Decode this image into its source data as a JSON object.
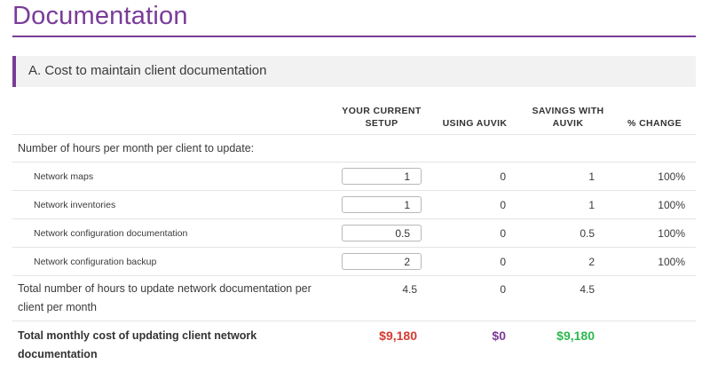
{
  "page": {
    "title": "Documentation"
  },
  "section": {
    "title": "A. Cost to maintain client documentation"
  },
  "columns": {
    "current": [
      "YOUR CURRENT",
      "SETUP"
    ],
    "auvik": "USING AUVIK",
    "savings": [
      "SAVINGS WITH",
      "AUVIK"
    ],
    "change": "% CHANGE"
  },
  "hours_heading": "Number of hours per month per client to update:",
  "rows": [
    {
      "label": "Network maps",
      "current": "1",
      "auvik": "0",
      "savings": "1",
      "change": "100%"
    },
    {
      "label": "Network inventories",
      "current": "1",
      "auvik": "0",
      "savings": "1",
      "change": "100%"
    },
    {
      "label": "Network configuration documentation",
      "current": "0.5",
      "auvik": "0",
      "savings": "0.5",
      "change": "100%"
    },
    {
      "label": "Network configuration backup",
      "current": "2",
      "auvik": "0",
      "savings": "2",
      "change": "100%"
    }
  ],
  "total_hours": {
    "label_lines": [
      "Total number of hours to update network documentation per",
      "client per month"
    ],
    "current": "4.5",
    "auvik": "0",
    "savings": "4.5"
  },
  "total_cost": {
    "label_lines": [
      "Total monthly cost of updating client network",
      "documentation"
    ],
    "current": "$9,180",
    "auvik": "$0",
    "savings": "$9,180"
  },
  "colors": {
    "accent": "#7a3b98",
    "negative": "#d63a2f",
    "neutral": "#7a3b98",
    "positive": "#2db84d"
  }
}
